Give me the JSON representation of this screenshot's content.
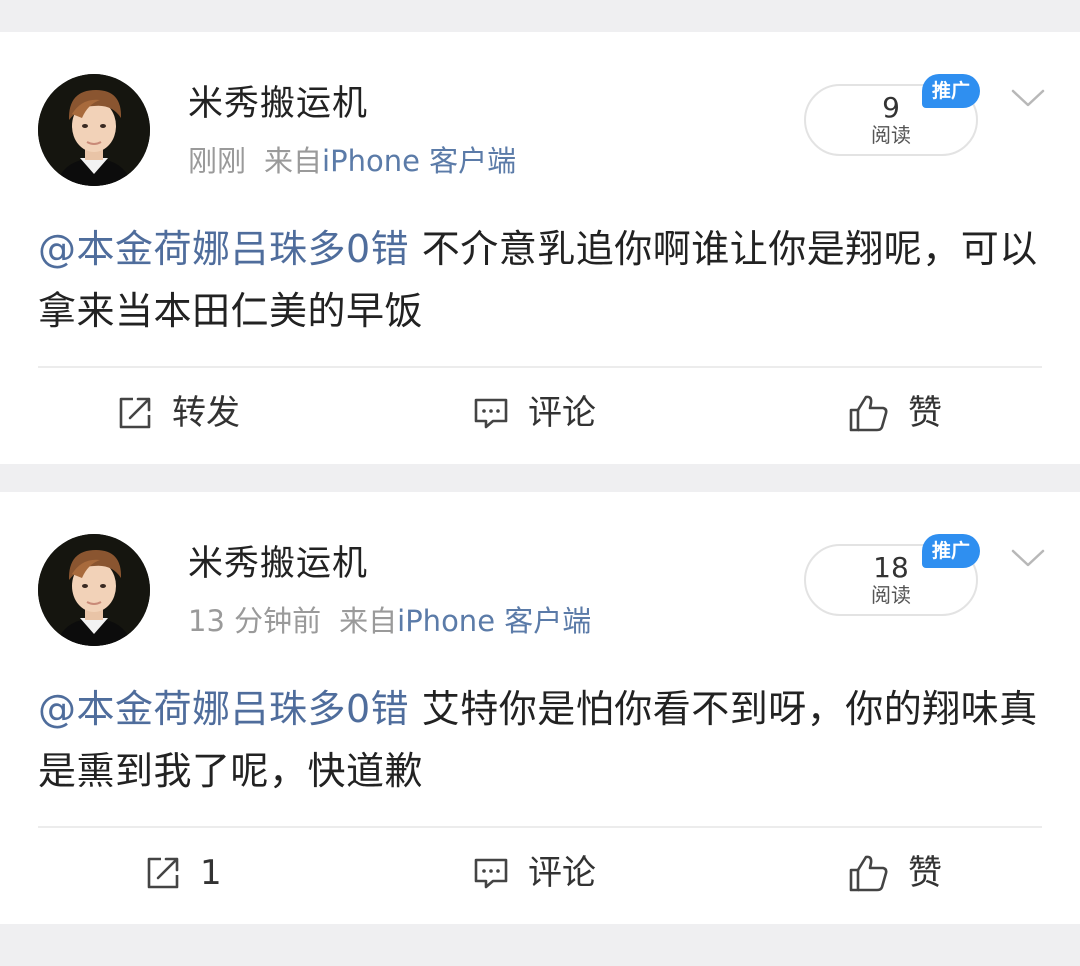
{
  "colors": {
    "background": "#efeff1",
    "card": "#ffffff",
    "mention": "#4f6d9c",
    "client_link": "#5b7ba8",
    "meta_text": "#9a9a9a",
    "promo_badge": "#2f8ff0"
  },
  "icons": {
    "repost": "share-arrow-box-icon",
    "comment": "speech-bubble-icon",
    "like": "thumbs-up-icon",
    "more": "chevron-down-icon"
  },
  "posts": [
    {
      "username": "米秀搬运机",
      "time": "刚刚",
      "source_prefix": "来自",
      "source_client": "iPhone 客户端",
      "read_count": "9",
      "read_label": "阅读",
      "promo_label": "推广",
      "mention": "@本金荷娜吕珠多0错",
      "text": " 不介意乳追你啊谁让你是翔呢，可以拿来当本田仁美的早饭",
      "actions": {
        "repost": "转发",
        "comment": "评论",
        "like": "赞"
      }
    },
    {
      "username": "米秀搬运机",
      "time": "13 分钟前",
      "source_prefix": "来自",
      "source_client": "iPhone 客户端",
      "read_count": "18",
      "read_label": "阅读",
      "promo_label": "推广",
      "mention": "@本金荷娜吕珠多0错",
      "text": " 艾特你是怕你看不到呀，你的翔味真是熏到我了呢，快道歉",
      "actions": {
        "repost": "1",
        "comment": "评论",
        "like": "赞"
      }
    }
  ]
}
